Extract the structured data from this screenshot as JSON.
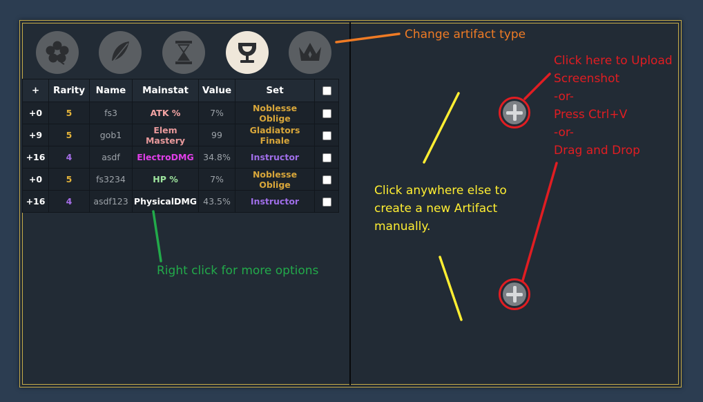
{
  "artifact_types": [
    {
      "name": "flower",
      "icon": "flower-icon",
      "active": false
    },
    {
      "name": "plume",
      "icon": "feather-icon",
      "active": false
    },
    {
      "name": "sands",
      "icon": "hourglass-icon",
      "active": false
    },
    {
      "name": "goblet",
      "icon": "goblet-icon",
      "active": true
    },
    {
      "name": "circlet",
      "icon": "crown-icon",
      "active": false
    }
  ],
  "table": {
    "headers": {
      "plus": "+",
      "rarity": "Rarity",
      "name": "Name",
      "mainstat": "Mainstat",
      "value": "Value",
      "set": "Set"
    },
    "rows": [
      {
        "plus": "+0",
        "rarity": "5",
        "name": "fs3",
        "mainstat": "ATK %",
        "value": "7%",
        "set": "Noblesse Oblige"
      },
      {
        "plus": "+9",
        "rarity": "5",
        "name": "gob1",
        "mainstat": "Elem Mastery",
        "value": "99",
        "set": "Gladiators Finale"
      },
      {
        "plus": "+16",
        "rarity": "4",
        "name": "asdf",
        "mainstat": "ElectroDMG",
        "value": "34.8%",
        "set": "Instructor"
      },
      {
        "plus": "+0",
        "rarity": "5",
        "name": "fs3234",
        "mainstat": "HP %",
        "value": "7%",
        "set": "Noblesse Oblige"
      },
      {
        "plus": "+16",
        "rarity": "4",
        "name": "asdf123",
        "mainstat": "PhysicalDMG",
        "value": "43.5%",
        "set": "Instructor"
      }
    ]
  },
  "annotations": {
    "change_type": "Change artifact type",
    "upload": [
      "Click here to Upload",
      "Screenshot",
      "-or-",
      "Press Ctrl+V",
      "-or-",
      "Drag and Drop"
    ],
    "create": [
      "Click anywhere else to",
      "create a new Artifact",
      "manually."
    ],
    "right_click": "Right click for more options"
  },
  "colors": {
    "frame_border": "#c8ad4a",
    "panel_bg": "#222b35",
    "page_bg": "#2c3d51",
    "rarity_5": "#e2b23a",
    "rarity_4": "#a66ee8",
    "atk": "#f4a4a4",
    "em": "#e8999b",
    "electro": "#e03fe8",
    "hp": "#9ee69e",
    "physical": "#ffffff",
    "set_noblesse": "#d8a63a",
    "set_gladiator": "#d8a63a",
    "set_instructor": "#9f6ee8",
    "annot_orange": "#ef7b25",
    "annot_red": "#e11d22",
    "annot_yellow": "#ffee32",
    "annot_green": "#22aa4a"
  }
}
